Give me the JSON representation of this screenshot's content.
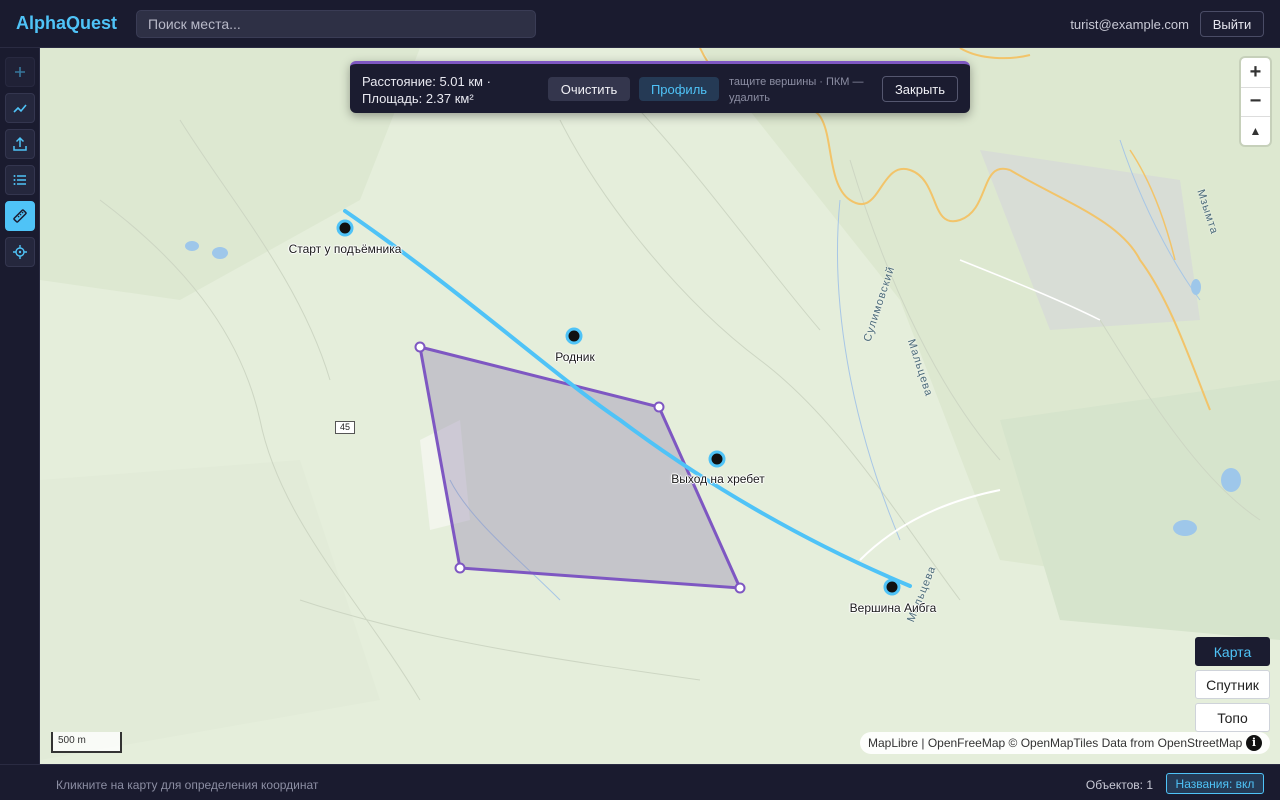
{
  "app": {
    "brand": "AlphaQuest"
  },
  "search": {
    "placeholder": "Поиск места..."
  },
  "user": {
    "email": "turist@example.com",
    "logout_label": "Выйти"
  },
  "sidebar": {
    "tools": [
      {
        "name": "add-point",
        "icon": "plus-icon"
      },
      {
        "name": "track",
        "icon": "track-line-icon"
      },
      {
        "name": "upload",
        "icon": "upload-icon"
      },
      {
        "name": "list",
        "icon": "list-icon"
      },
      {
        "name": "ruler",
        "icon": "ruler-icon",
        "active": true
      },
      {
        "name": "locate",
        "icon": "crosshair-icon"
      }
    ]
  },
  "measure": {
    "distance": "Расстояние: 5.01 км ·",
    "area": "Площадь: 2.37 км²",
    "clear_label": "Очистить",
    "profile_label": "Профиль",
    "hint": "тащите вершины · ПКМ — удалить",
    "close_label": "Закрыть"
  },
  "map": {
    "zoom_in": "+",
    "zoom_out": "−",
    "compass": "▲",
    "markers": [
      {
        "label": "Старт у подъёмника"
      },
      {
        "label": "Родник"
      },
      {
        "label": "Выход на хребет"
      },
      {
        "label": "Вершина Аибга"
      }
    ],
    "road_number": "45",
    "street_labels": [
      "Сулимовский",
      "Мальцева",
      "Мальцева",
      "Мзымта"
    ],
    "scale_label": "500 m",
    "attribution": "MapLibre | OpenFreeMap © OpenMapTiles Data from OpenStreetMap",
    "info_icon": "i"
  },
  "layers": {
    "map": "Карта",
    "satellite": "Спутник",
    "topo": "Топо",
    "active": "map"
  },
  "status": {
    "hint": "Кликните на карту для определения координат",
    "objects": "Объектов: 1",
    "names_toggle": "Названия: вкл"
  },
  "colors": {
    "accent": "#4fc3f7",
    "track": "#4fc3f7",
    "polygon": "#7e57c2",
    "map_bg": "#e5eedb"
  }
}
